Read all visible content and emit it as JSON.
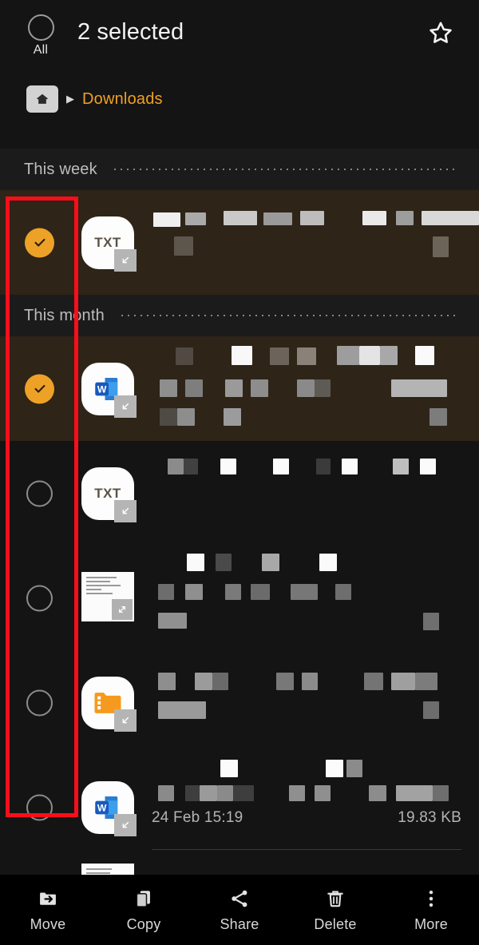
{
  "appbar": {
    "select_all_label": "All",
    "select_all_icon": "circle-unchecked-icon",
    "title": "2 selected",
    "favorite_icon": "star-outline-icon"
  },
  "breadcrumb": {
    "home_icon": "home-folder-icon",
    "separator": "▶",
    "current": "Downloads"
  },
  "sections": [
    {
      "label": "This week"
    },
    {
      "label": "This month"
    }
  ],
  "rows": [
    {
      "selected": true,
      "check_icon": "checkbox-checked-icon",
      "icon": "txt-file-icon",
      "icon_label": "TXT",
      "badge_icon": "download-badge-icon",
      "name": "",
      "date": "",
      "size": ""
    },
    {
      "selected": true,
      "check_icon": "checkbox-checked-icon",
      "icon": "word-file-icon",
      "icon_label": "W",
      "badge_icon": "download-badge-icon",
      "name": "",
      "date": "",
      "size": ""
    },
    {
      "selected": false,
      "check_icon": "checkbox-unchecked-icon",
      "icon": "txt-file-icon",
      "icon_label": "TXT",
      "badge_icon": "download-badge-icon",
      "name": "",
      "date": "",
      "size": ""
    },
    {
      "selected": false,
      "check_icon": "checkbox-unchecked-icon",
      "icon": "document-thumbnail-icon",
      "icon_label": "",
      "badge_icon": "expand-badge-icon",
      "name": "",
      "date": "",
      "size": ""
    },
    {
      "selected": false,
      "check_icon": "checkbox-unchecked-icon",
      "icon": "archive-folder-icon",
      "icon_label": "",
      "badge_icon": "download-badge-icon",
      "name": "",
      "date": "",
      "size": ""
    },
    {
      "selected": false,
      "check_icon": "checkbox-unchecked-icon",
      "icon": "word-file-icon",
      "icon_label": "W",
      "badge_icon": "download-badge-icon",
      "name": "",
      "date": "24 Feb 15:19",
      "size": "19.83 KB"
    }
  ],
  "toolbar": {
    "items": [
      {
        "label": "Move",
        "icon": "move-to-folder-icon"
      },
      {
        "label": "Copy",
        "icon": "copy-icon"
      },
      {
        "label": "Share",
        "icon": "share-icon"
      },
      {
        "label": "Delete",
        "icon": "trash-icon"
      },
      {
        "label": "More",
        "icon": "overflow-menu-icon"
      }
    ]
  },
  "annotation": {
    "shape": "rectangle",
    "color": "#fc0d1b",
    "target": "selection-checkbox-column"
  },
  "colors": {
    "background": "#141414",
    "section_background": "#1b1b1b",
    "row_selected": "#2e2418",
    "accent": "#eda227",
    "breadcrumb_current": "#f0a024",
    "annotation": "#fc0d1b",
    "toolbar_background": "#000000"
  }
}
